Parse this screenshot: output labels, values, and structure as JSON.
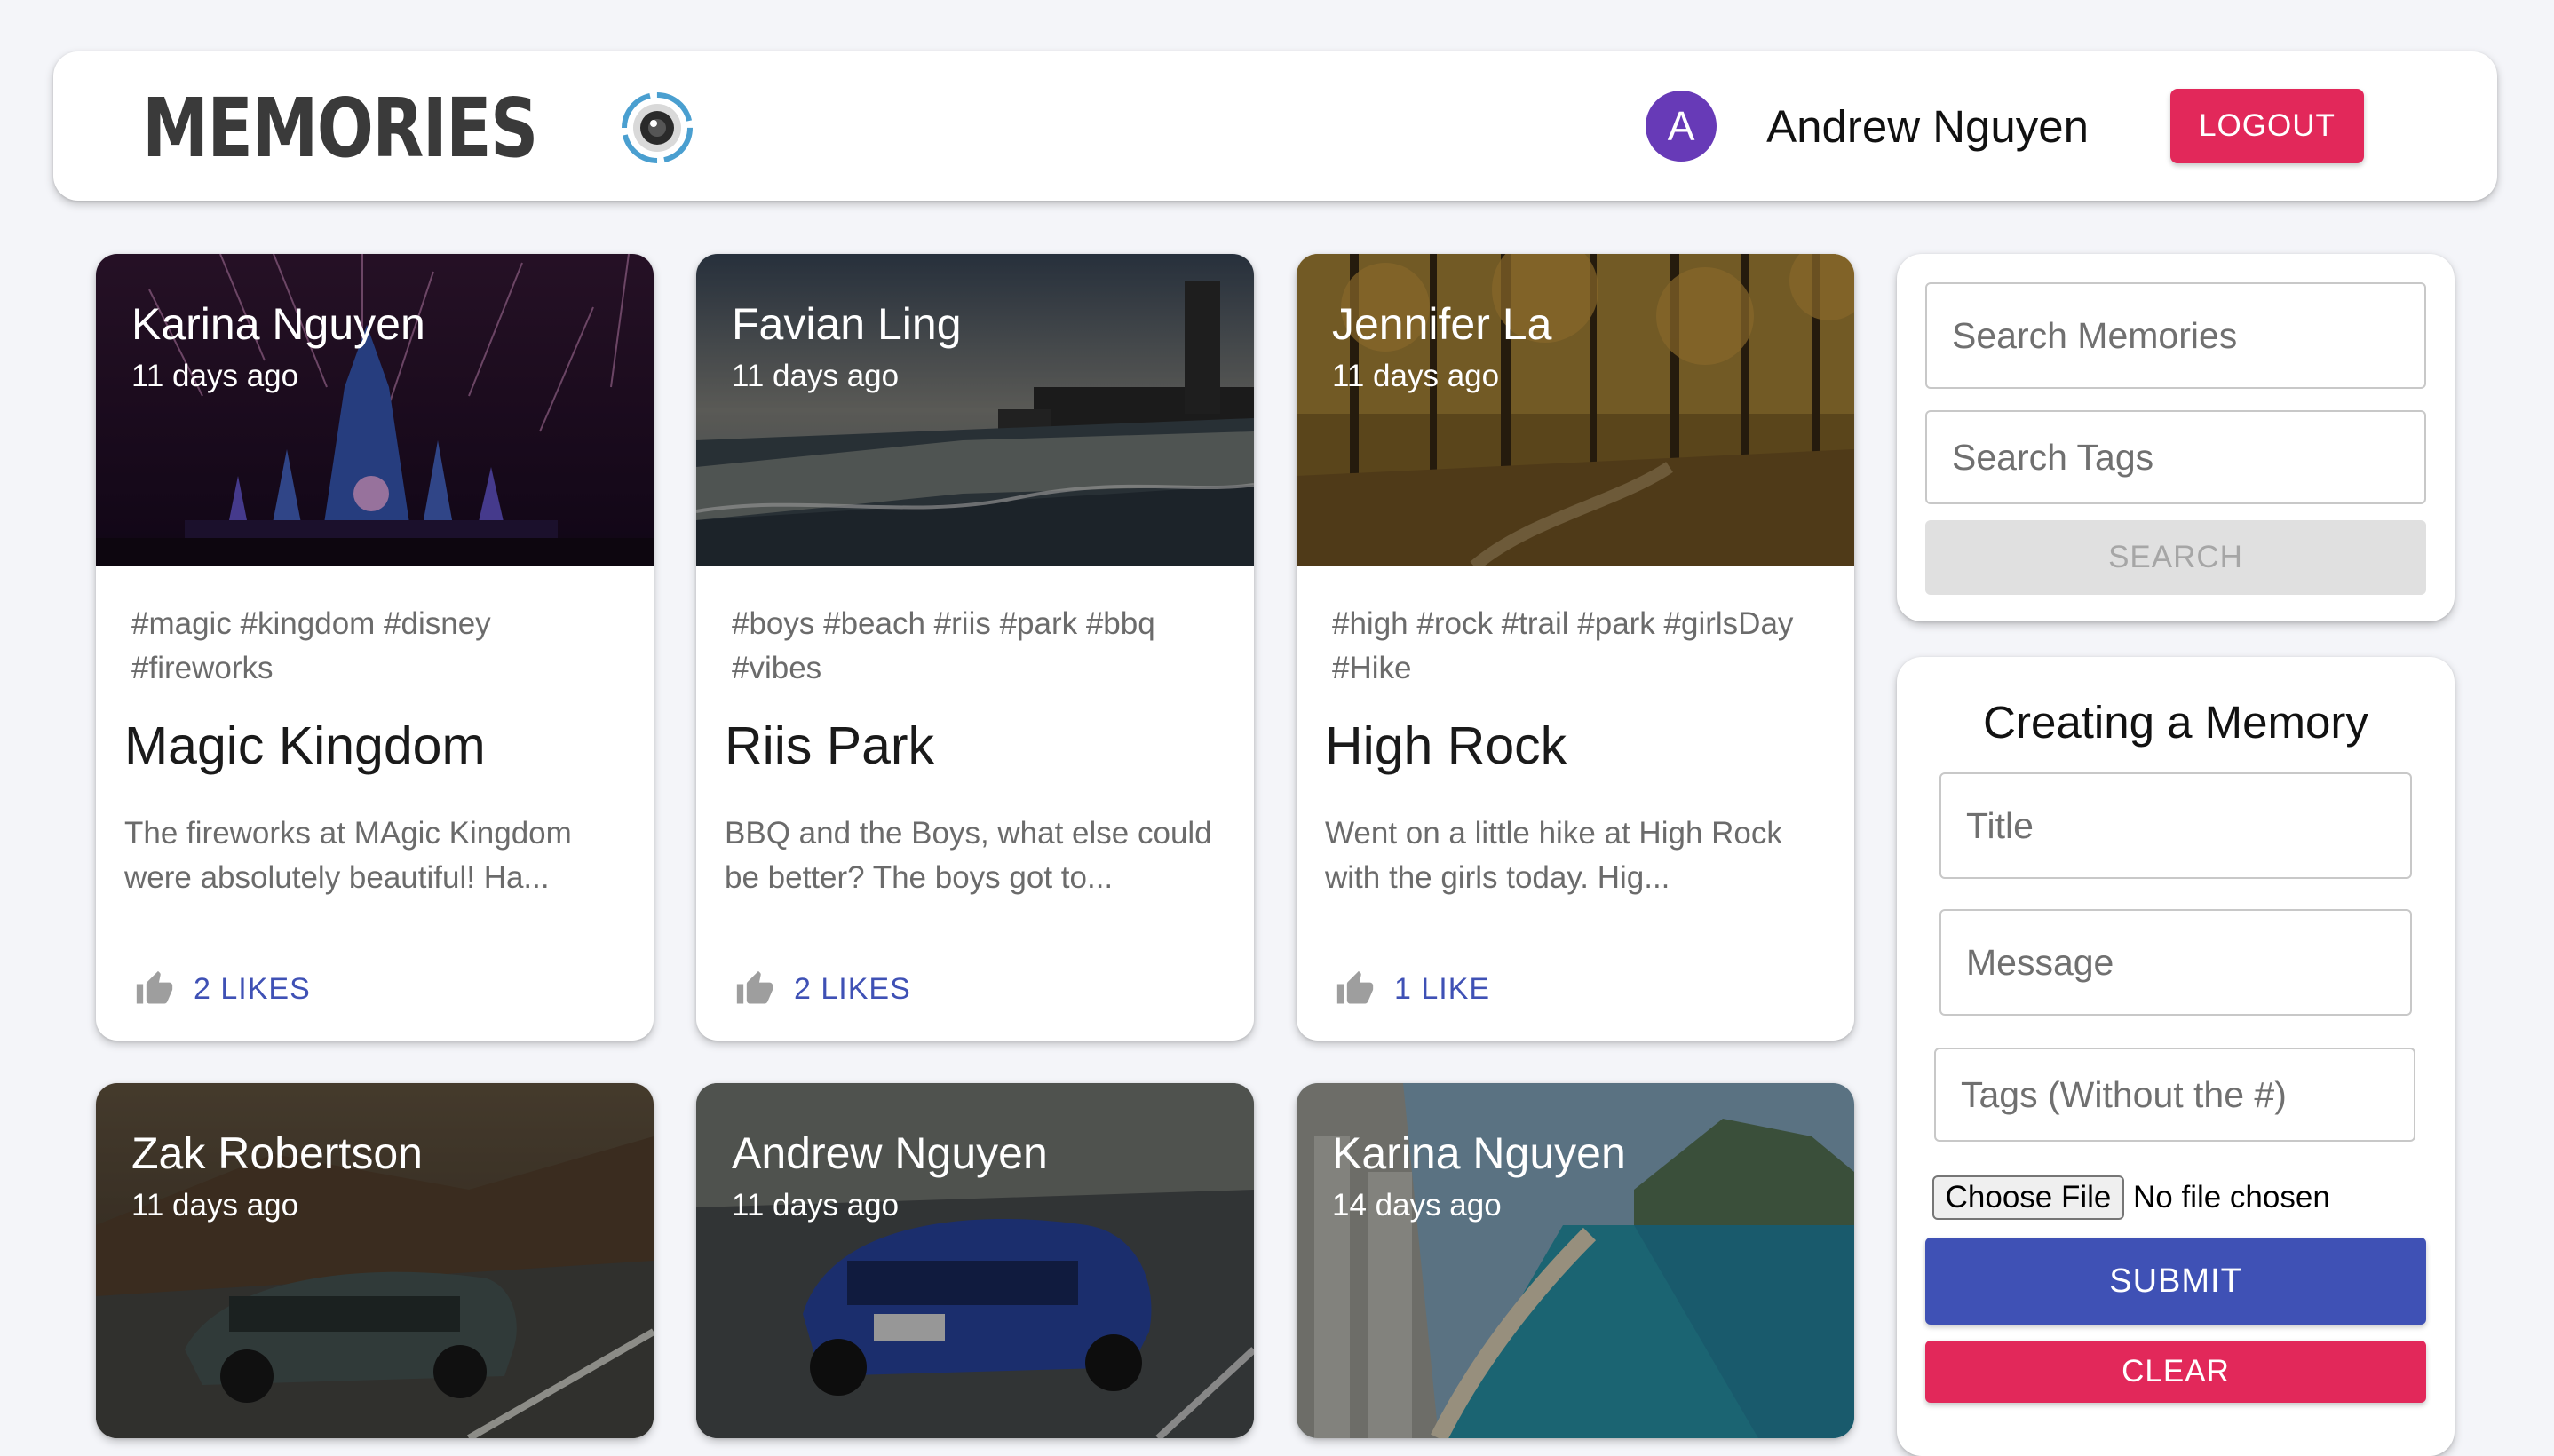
{
  "header": {
    "brand_title": "Memories",
    "brand_title_display": "MEMORIES",
    "avatar_initial": "A",
    "username": "Andrew Nguyen",
    "logout_label": "LOGOUT"
  },
  "posts": [
    {
      "author": "Karina Nguyen",
      "time": "11 days ago",
      "tags": "#magic #kingdom #disney #fireworks",
      "title": "Magic Kingdom",
      "message": "The fireworks at MAgic Kingdom were absolutely beautiful! Ha...",
      "likes": "2 LIKES"
    },
    {
      "author": "Favian Ling",
      "time": "11 days ago",
      "tags": "#boys #beach #riis #park #bbq #vibes",
      "title": "Riis Park",
      "message": "BBQ and the Boys, what else could be better? The boys got to...",
      "likes": "2 LIKES"
    },
    {
      "author": "Jennifer La",
      "time": "11 days ago",
      "tags": "#high #rock #trail #park #girlsDay #Hike",
      "title": "High Rock",
      "message": "Went on a little hike at High Rock with the girls today. Hig...",
      "likes": "1 LIKE"
    },
    {
      "author": "Zak Robertson",
      "time": "11 days ago"
    },
    {
      "author": "Andrew Nguyen",
      "time": "11 days ago"
    },
    {
      "author": "Karina Nguyen",
      "time": "14 days ago"
    }
  ],
  "search": {
    "memories_placeholder": "Search Memories",
    "tags_placeholder": "Search Tags",
    "button_label": "SEARCH"
  },
  "form": {
    "heading": "Creating a Memory",
    "title_placeholder": "Title",
    "message_placeholder": "Message",
    "tags_placeholder": "Tags (Without the #)",
    "choose_file_label": "Choose File",
    "no_file_label": "No file chosen",
    "submit_label": "SUBMIT",
    "clear_label": "CLEAR"
  },
  "colors": {
    "primary": "#3f51b5",
    "secondary": "#e2285a",
    "avatar": "#673ab7",
    "background": "#f4f5f9"
  },
  "icons": {
    "brand": "camera-lens-icon",
    "like": "thumb-up-icon"
  }
}
